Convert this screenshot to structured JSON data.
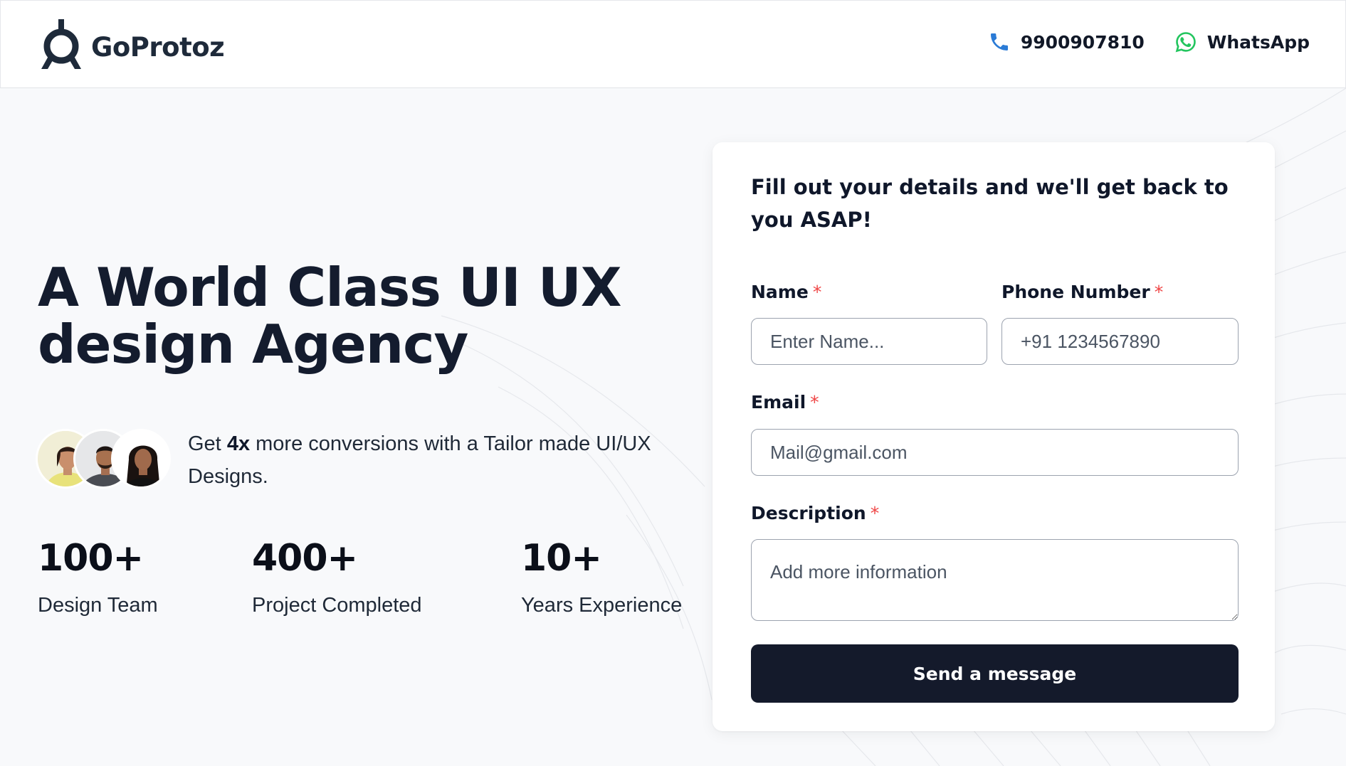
{
  "brand": {
    "name": "GoProtoz"
  },
  "header": {
    "phone": {
      "icon": "phone-icon",
      "text": "9900907810",
      "color": "#2563eb"
    },
    "whatsapp": {
      "icon": "whatsapp-icon",
      "text": "WhatsApp",
      "color": "#22c55e"
    }
  },
  "hero": {
    "title_line1": "A World Class UI UX",
    "title_line2": "design Agency",
    "tagline_pre": "Get ",
    "tagline_bold": "4x",
    "tagline_post": " more conversions with a Tailor made UI/UX Designs."
  },
  "stats": [
    {
      "value": "100+",
      "label": "Design Team"
    },
    {
      "value": "400+",
      "label": "Project Completed"
    },
    {
      "value": "10+",
      "label": "Years Experience"
    }
  ],
  "form": {
    "title": "Fill out your details and we'll get back to you ASAP!",
    "required_mark": "*",
    "name": {
      "label": "Name",
      "placeholder": "Enter Name..."
    },
    "phone": {
      "label": "Phone Number",
      "placeholder": "+91 1234567890"
    },
    "email": {
      "label": "Email",
      "placeholder": "Mail@gmail.com"
    },
    "description": {
      "label": "Description",
      "placeholder": "Add more information"
    },
    "submit_label": "Send a message"
  },
  "colors": {
    "primary_dark": "#141a2b",
    "required": "#ef4444",
    "background": "#f8f9fb"
  }
}
